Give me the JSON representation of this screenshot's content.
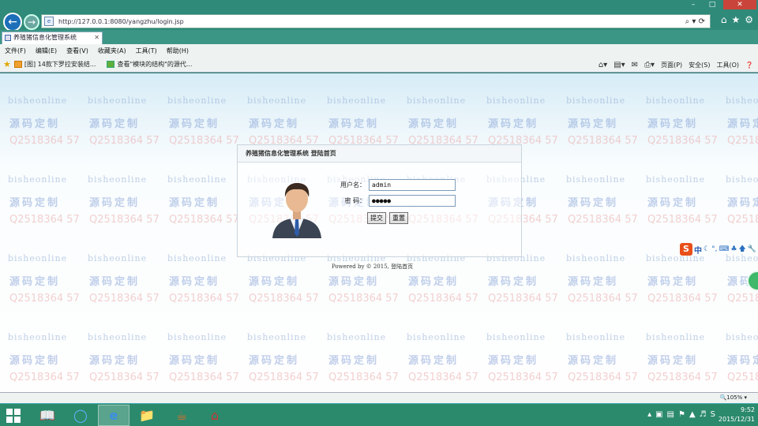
{
  "browser": {
    "url": "http://127.0.0.1:8080/yangzhu/login.jsp",
    "tab_title": "养殖猪信息化管理系统",
    "window": {
      "minimize": "–",
      "maximize": "□",
      "close": "✕"
    },
    "address_tools": "⌕ ▾ ⟳",
    "chrome_icons": [
      "home-icon",
      "star-icon",
      "gear-icon"
    ]
  },
  "menu": [
    "文件(F)",
    "编辑(E)",
    "查看(V)",
    "收藏夹(A)",
    "工具(T)",
    "帮助(H)"
  ],
  "favorites": [
    {
      "label": "[图] 14款下罗拉安装结...",
      "icon": "orange"
    },
    {
      "label": "查看\"模块的结构\"的源代...",
      "icon": "green"
    }
  ],
  "command_bar": {
    "page": "页面(P)",
    "safety": "安全(S)",
    "tools": "工具(O)",
    "help": "❓"
  },
  "watermark": {
    "site": "bisheonline",
    "slogan": "源码定制",
    "qq": "Q2518364 57"
  },
  "login": {
    "header": "养殖猪信息化管理系统 登陆首页",
    "username_label": "用户名：",
    "username_value": "admin",
    "password_label": "密  码：",
    "password_value": "●●●●●",
    "submit_label": "提交",
    "reset_label": "重置"
  },
  "footer": "Powered by © 2015, 登陆首页",
  "ime": {
    "logo": "S",
    "mode": "中"
  },
  "status": {
    "zoom": "🔍105% ▾"
  },
  "taskbar": {
    "time": "9:52",
    "date": "2015/12/31"
  },
  "colors": {
    "taskbar": "#2c8a6c",
    "titlebar": "#2f8a7a",
    "close": "#c9443a",
    "ime": "#e8501a"
  }
}
